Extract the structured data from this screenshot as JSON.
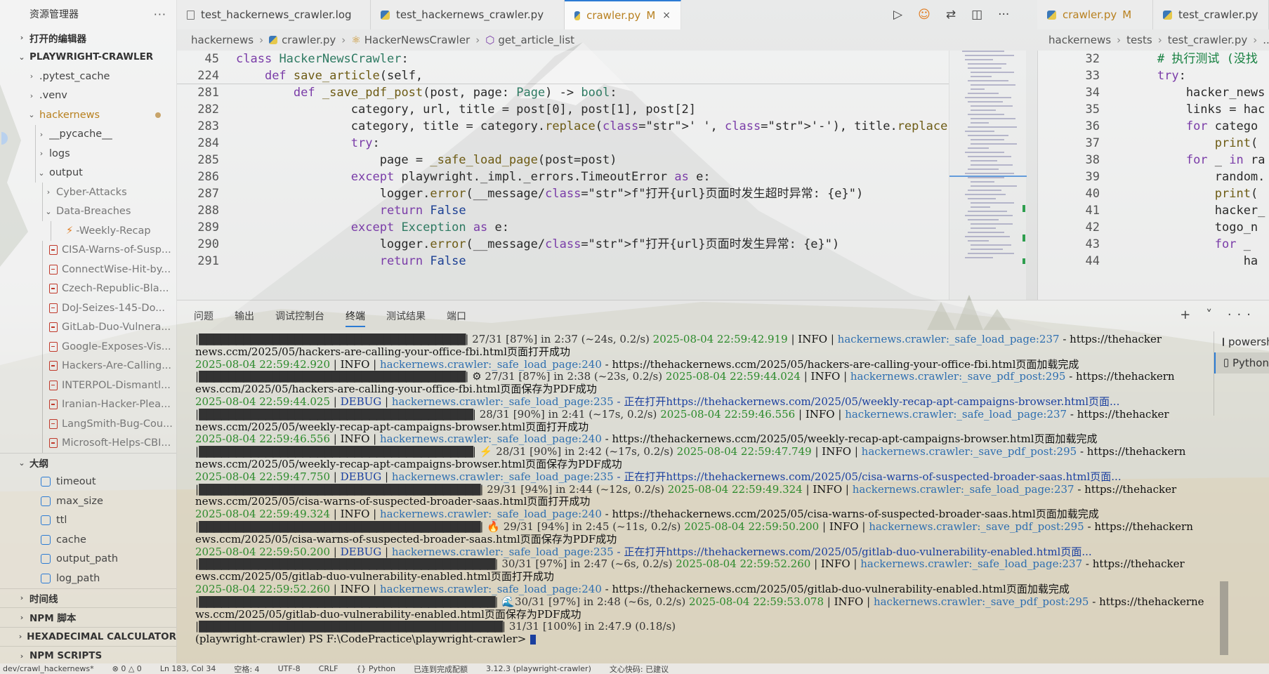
{
  "explorer": {
    "title": "资源管理器",
    "more": "···",
    "sections": {
      "open_editors": "打开的编辑器",
      "project": "PLAYWRIGHT-CRAWLER",
      "outline": "大纲",
      "timeline": "时间线",
      "npm_script": "NPM 脚本",
      "hex_calc": "HEXADECIMAL CALCULATOR",
      "npm_scripts": "NPM SCRIPTS"
    },
    "folders": [
      ".pytest_cache",
      ".venv",
      "hackernews",
      "__pycache__",
      "logs",
      "output",
      "Cyber-Attacks",
      "Data-Breaches"
    ],
    "files": [
      "-Weekly-Recap",
      "CISA-Warns-of-Susp...",
      "ConnectWise-Hit-by...",
      "Czech-Republic-Bla...",
      "DoJ-Seizes-145-Do...",
      "GitLab-Duo-Vulnera...",
      "Google-Exposes-Vis...",
      "Hackers-Are-Calling...",
      "INTERPOL-Dismantl...",
      "Iranian-Hacker-Plea...",
      "LangSmith-Bug-Cou...",
      "Microsoft-Helps-CBI..."
    ],
    "outline_items": [
      "timeout",
      "max_size",
      "ttl",
      "cache",
      "output_path",
      "log_path"
    ]
  },
  "tabs": [
    {
      "label": "test_hackernews_crawler.log",
      "icon": "log-file-icon"
    },
    {
      "label": "test_hackernews_crawler.py",
      "icon": "python-file-icon"
    },
    {
      "label": "crawler.py",
      "flag": "M",
      "close": "×",
      "icon": "python-file-icon"
    },
    {
      "label": "crawler.py",
      "flag": "M",
      "icon": "python-file-icon"
    },
    {
      "label": "test_crawler.py",
      "icon": "python-file-icon"
    }
  ],
  "toolbar": {
    "run": "▷",
    "copilot": "☺",
    "compare": "⇄",
    "split": "◫",
    "more": "···"
  },
  "breadcrumb_left": [
    "hackernews",
    "crawler.py",
    "HackerNewsCrawler",
    "get_article_list"
  ],
  "breadcrumb_right": [
    "hackernews",
    "tests",
    "test_crawler.py",
    "..."
  ],
  "editor_lines": [
    {
      "n": "45",
      "code": "class HackerNewsCrawler:"
    },
    {
      "n": "224",
      "code": "    def save_article(self,"
    },
    {
      "n": "281",
      "code": "        def _save_pdf_post(post, page: Page) -> bool:"
    },
    {
      "n": "282",
      "code": "                category, url, title = post[0], post[1], post[2]"
    },
    {
      "n": "283",
      "code": "                category, title = category.replace(' ', '-'), title.replace(' ', '-')"
    },
    {
      "n": "284",
      "code": "                try:"
    },
    {
      "n": "285",
      "code": "                    page = _safe_load_page(post=post)"
    },
    {
      "n": "286",
      "code": "                except playwright._impl._errors.TimeoutError as e:"
    },
    {
      "n": "287",
      "code": "                    logger.error(__message/f\"打开{url}页面时发生超时异常: {e}\")"
    },
    {
      "n": "288",
      "code": "                    return False"
    },
    {
      "n": "289",
      "code": "                except Exception as e:"
    },
    {
      "n": "290",
      "code": "                    logger.error(__message/f\"打开{url}页面时发生异常: {e}\")"
    },
    {
      "n": "291",
      "code": "                    return False"
    }
  ],
  "right_lines": [
    {
      "n": "32",
      "code": "        # 执行测试 (没找"
    },
    {
      "n": "33",
      "code": "        try:"
    },
    {
      "n": "34",
      "code": "            hacker_news"
    },
    {
      "n": "35",
      "code": "            links = hac"
    },
    {
      "n": "36",
      "code": "            for catego"
    },
    {
      "n": "37",
      "code": "                print("
    },
    {
      "n": "38",
      "code": "            for _ in ra"
    },
    {
      "n": "39",
      "code": "                random."
    },
    {
      "n": "40",
      "code": "                print("
    },
    {
      "n": "41",
      "code": "                hacker_"
    },
    {
      "n": "42",
      "code": "                togo_n"
    },
    {
      "n": "43",
      "code": "                for _"
    },
    {
      "n": "44",
      "code": "                    ha"
    }
  ],
  "panel_tabs": [
    "问题",
    "输出",
    "调试控制台",
    "终端",
    "测试结果",
    "端口"
  ],
  "panel_actions": "+ ˅ ···",
  "shells": [
    "powershell",
    "Python"
  ],
  "terminal": [
    {
      "bar": "████████████████████████████████████",
      "icon": "",
      "prog": " 27/31 [87%] in 2:37 (~24s, 0.2/s)",
      "ts": "2025-08-04 22:59:42.919",
      "lvl": "INFO",
      "src": "hackernews.crawler:_safe_load_page:237",
      "msg": "- https://thehacker"
    },
    {
      "text": "news.ccm/2025/05/hackers-are-calling-your-office-fbi.html页面打开成功"
    },
    {
      "ts": "2025-08-04 22:59:42.920",
      "lvl": "INFO",
      "src": "hackernews.crawler:_safe_load_page:240",
      "msg": "- https://thehackernews.ccm/2025/05/hackers-are-calling-your-office-fbi.html页面加载完成"
    },
    {
      "bar": "████████████████████████████████████",
      "icon": "⚙",
      "prog": " 27/31 [87%] in 2:38 (~23s, 0.2/s)",
      "ts": "2025-08-04 22:59:44.024",
      "lvl": "INFO",
      "src": "hackernews.crawler:_save_pdf_post:295",
      "msg": "- https://thehackern"
    },
    {
      "text": "ews.ccm/2025/05/hackers-are-calling-your-office-fbi.html页面保存为PDF成功"
    },
    {
      "ts": "2025-08-04 22:59:44.025",
      "lvl": "DEBUG",
      "src": "hackernews.crawler:_safe_load_page:235",
      "msg": "- 正在打开https://thehackernews.com/2025/05/weekly-recap-apt-campaigns-browser.html页面..."
    },
    {
      "bar": "█████████████████████████████████████",
      "icon": "",
      "prog": " 28/31 [90%] in 2:41 (~17s, 0.2/s)",
      "ts": "2025-08-04 22:59:46.556",
      "lvl": "INFO",
      "src": "hackernews.crawler:_safe_load_page:237",
      "msg": "- https://thehacker"
    },
    {
      "text": "news.ccm/2025/05/weekly-recap-apt-campaigns-browser.html页面打开成功"
    },
    {
      "ts": "2025-08-04 22:59:46.556",
      "lvl": "INFO",
      "src": "hackernews.crawler:_safe_load_page:240",
      "msg": "- https://thehackernews.ccm/2025/05/weekly-recap-apt-campaigns-browser.html页面加载完成"
    },
    {
      "bar": "█████████████████████████████████████",
      "icon": "⚡",
      "prog": " 28/31 [90%] in 2:42 (~17s, 0.2/s)",
      "ts": "2025-08-04 22:59:47.749",
      "lvl": "INFO",
      "src": "hackernews.crawler:_save_pdf_post:295",
      "msg": "- https://thehackern"
    },
    {
      "text": "news.ccm/2025/05/weekly-recap-apt-campaigns-browser.html页面保存为PDF成功"
    },
    {
      "ts": "2025-08-04 22:59:47.750",
      "lvl": "DEBUG",
      "src": "hackernews.crawler:_safe_load_page:235",
      "msg": "- 正在打开https://thehackernews.com/2025/05/cisa-warns-of-suspected-broader-saas.html页面..."
    },
    {
      "bar": "██████████████████████████████████████",
      "icon": "",
      "prog": " 29/31 [94%] in 2:44 (~12s, 0.2/s)",
      "ts": "2025-08-04 22:59:49.324",
      "lvl": "INFO",
      "src": "hackernews.crawler:_safe_load_page:237",
      "msg": "- https://thehacker"
    },
    {
      "text": "news.ccm/2025/05/cisa-warns-of-suspected-broader-saas.html页面打开成功"
    },
    {
      "ts": "2025-08-04 22:59:49.324",
      "lvl": "INFO",
      "src": "hackernews.crawler:_safe_load_page:240",
      "msg": "- https://thehackernews.ccm/2025/05/cisa-warns-of-suspected-broader-saas.html页面加载完成"
    },
    {
      "bar": "██████████████████████████████████████",
      "icon": "🔥",
      "prog": " 29/31 [94%] in 2:45 (~11s, 0.2/s)",
      "ts": "2025-08-04 22:59:50.200",
      "lvl": "INFO",
      "src": "hackernews.crawler:_save_pdf_post:295",
      "msg": "- https://thehackern"
    },
    {
      "text": "ews.ccm/2025/05/cisa-warns-of-suspected-broader-saas.html页面保存为PDF成功"
    },
    {
      "ts": "2025-08-04 22:59:50.200",
      "lvl": "DEBUG",
      "src": "hackernews.crawler:_safe_load_page:235",
      "msg": "- 正在打开https://thehackernews.com/2025/05/gitlab-duo-vulnerability-enabled.html页面..."
    },
    {
      "bar": "████████████████████████████████████████",
      "icon": "",
      "prog": " 30/31 [97%] in 2:47 (~6s, 0.2/s)",
      "ts": "2025-08-04 22:59:52.260",
      "lvl": "INFO",
      "src": "hackernews.crawler:_safe_load_page:237",
      "msg": "- https://thehacker"
    },
    {
      "text": "ews.ccm/2025/05/gitlab-duo-vulnerability-enabled.html页面打开成功"
    },
    {
      "ts": "2025-08-04 22:59:52.260",
      "lvl": "INFO",
      "src": "hackernews.crawler:_safe_load_page:240",
      "msg": "- https://thehackernews.ccm/2025/05/gitlab-duo-vulnerability-enabled.html页面加载完成"
    },
    {
      "bar": "████████████████████████████████████████",
      "icon": "🌊",
      "prog": "30/31 [97%] in 2:48 (~6s, 0.2/s)",
      "ts": "2025-08-04 22:59:53.078",
      "lvl": "INFO",
      "src": "hackernews.crawler:_save_pdf_post:295",
      "msg": "- https://thehackerne"
    },
    {
      "text": "ws.ccm/2025/05/gitlab-duo-vulnerability-enabled.html页面保存为PDF成功"
    },
    {
      "bar": "█████████████████████████████████████████",
      "icon": "",
      "prog": " 31/31 [100%] in 2:47.9 (0.18/s)"
    },
    {
      "prompt": "(playwright-crawler) PS F:\\CodePractice\\playwright-crawler>"
    }
  ],
  "statusbar": [
    "dev/crawl_hackernews*",
    "⊗ 0 △ 0",
    "Ln 183, Col 34",
    "空格: 4",
    "UTF-8",
    "CRLF",
    "{} Python",
    "已连到完成配额",
    "3.12.3 (playwright-crawler)",
    "文心快码: 已建议"
  ],
  "colors": {
    "accent": "#2b7bd4",
    "modified": "#b8801f",
    "info_ts": "#2b8a2b",
    "debug": "#1a3f9f",
    "src": "#2f6fb0"
  }
}
